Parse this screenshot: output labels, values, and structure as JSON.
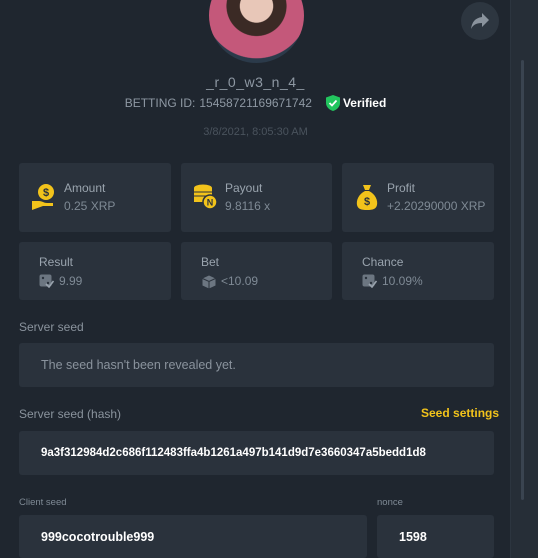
{
  "profile": {
    "username": "_r_0_w3_n_4_",
    "betting_id_label": "BETTING ID:",
    "betting_id": "15458721169671742",
    "verified_label": "Verified",
    "datetime": "3/8/2021, 8:05:30 AM"
  },
  "stats": {
    "amount": {
      "label": "Amount",
      "value": "0.25 XRP",
      "icon": "coin-hand-icon"
    },
    "payout": {
      "label": "Payout",
      "value": "9.8116 x",
      "icon": "coin-stack-icon"
    },
    "profit": {
      "label": "Profit",
      "value": "+2.20290000 XRP",
      "icon": "money-bag-icon"
    }
  },
  "roll": {
    "result": {
      "label": "Result",
      "value": "9.99"
    },
    "bet": {
      "label": "Bet",
      "value": "<10.09"
    },
    "chance": {
      "label": "Chance",
      "value": "10.09%"
    }
  },
  "server_seed": {
    "label": "Server seed",
    "value": "The seed hasn't been revealed yet."
  },
  "server_seed_hash": {
    "label": "Server seed (hash)",
    "value": "9a3f312984d2c686f112483ffa4b1261a497b141d9d7e3660347a5bedd1d8",
    "settings_link": "Seed settings"
  },
  "client_seed": {
    "label": "Client seed",
    "value": "999cocotrouble999"
  },
  "nonce": {
    "label": "nonce",
    "value": "1598"
  },
  "colors": {
    "accent": "#f2c31b",
    "verified": "#22c55e",
    "background": "#1f262f",
    "card": "#2a323c"
  }
}
